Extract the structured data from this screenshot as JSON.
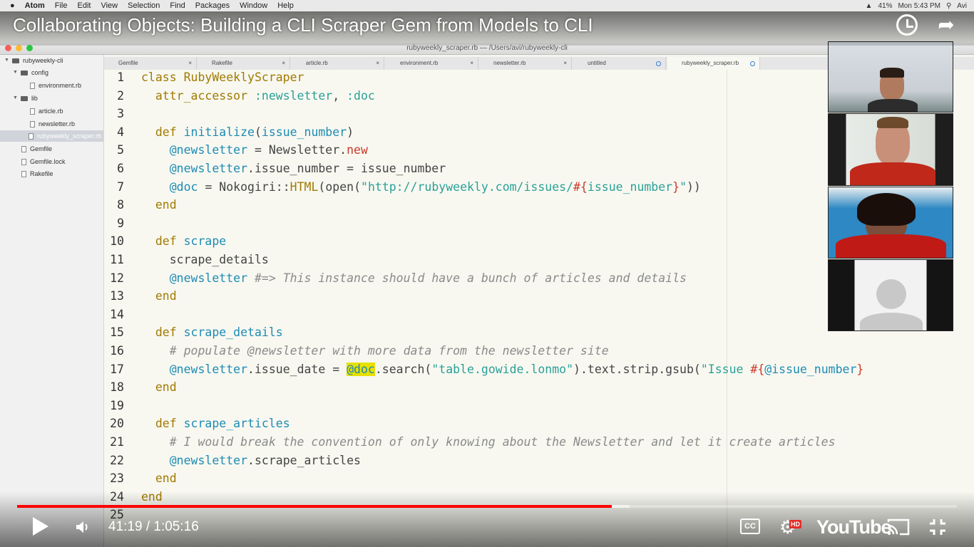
{
  "menubar": {
    "items": [
      "Atom",
      "File",
      "Edit",
      "View",
      "Selection",
      "Find",
      "Packages",
      "Window",
      "Help"
    ],
    "battery": "41%",
    "clock": "Mon 5:43 PM",
    "user": "Avi"
  },
  "window": {
    "title": "rubyweekly_scraper.rb — /Users/avi/rubyweekly-cli"
  },
  "tree": {
    "items": [
      {
        "label": "rubyweekly-cli",
        "type": "folder"
      },
      {
        "label": "config",
        "type": "folder"
      },
      {
        "label": "environment.rb",
        "type": "file"
      },
      {
        "label": "lib",
        "type": "folder"
      },
      {
        "label": "article.rb",
        "type": "file"
      },
      {
        "label": "newsletter.rb",
        "type": "file"
      },
      {
        "label": "rubyweekly_scraper.rb",
        "type": "file",
        "selected": true
      },
      {
        "label": "Gemfile",
        "type": "file"
      },
      {
        "label": "Gemfile.lock",
        "type": "file"
      },
      {
        "label": "Rakefile",
        "type": "file"
      }
    ]
  },
  "tabs": [
    {
      "label": "Gemfile",
      "icon": "close"
    },
    {
      "label": "Rakefile",
      "icon": "close"
    },
    {
      "label": "article.rb",
      "icon": "close"
    },
    {
      "label": "environment.rb",
      "icon": "close"
    },
    {
      "label": "newsletter.rb",
      "icon": "close"
    },
    {
      "label": "untitled",
      "icon": "modified"
    },
    {
      "label": "rubyweekly_scraper.rb",
      "icon": "modified",
      "active": true
    }
  ],
  "code": {
    "line_numbers": [
      "1",
      "2",
      "3",
      "4",
      "5",
      "6",
      "7",
      "8",
      "9",
      "10",
      "11",
      "12",
      "13",
      "14",
      "15",
      "16",
      "17",
      "18",
      "19",
      "20",
      "21",
      "22",
      "23",
      "24",
      "25"
    ]
  },
  "video": {
    "title": "Collaborating Objects: Building a CLI Scraper Gem from Models to CLI",
    "time": "41:19 / 1:05:16",
    "played_fraction": 0.633,
    "buffered_fraction": 0.652,
    "hd_badge": "HD",
    "cc_label": "CC",
    "logo": "YouTube"
  }
}
